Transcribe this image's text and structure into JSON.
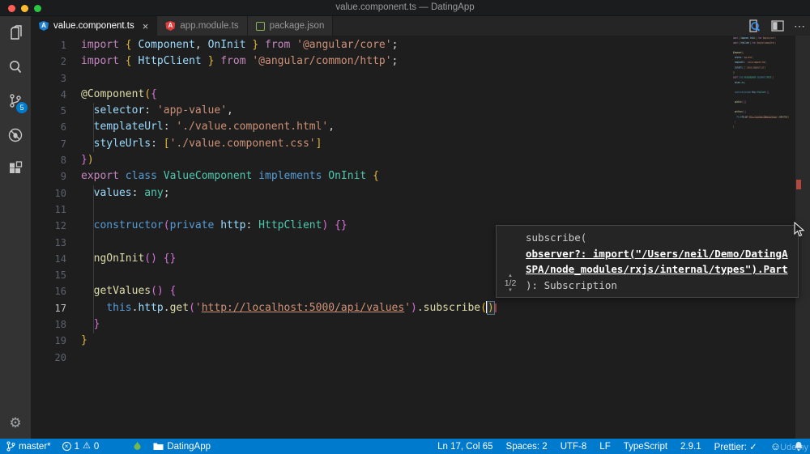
{
  "window": {
    "title": "value.component.ts — DatingApp"
  },
  "tabs": [
    {
      "label": "value.component.ts",
      "icon": "angular-blue",
      "active": true,
      "close_label": "×"
    },
    {
      "label": "app.module.ts",
      "icon": "angular-red",
      "active": false
    },
    {
      "label": "package.json",
      "icon": "npm",
      "active": false
    }
  ],
  "editor_actions": {
    "more_label": "⋯"
  },
  "activity_bar": {
    "scm_badge": "5",
    "gear_glyph": "⚙"
  },
  "editor": {
    "current_line": 17,
    "lines": [
      [
        [
          "kw",
          "import"
        ],
        [
          "pun",
          " "
        ],
        [
          "b1",
          "{"
        ],
        [
          "pun",
          " "
        ],
        [
          "var",
          "Component"
        ],
        [
          "pun",
          ", "
        ],
        [
          "var",
          "OnInit"
        ],
        [
          "pun",
          " "
        ],
        [
          "b1",
          "}"
        ],
        [
          "pun",
          " "
        ],
        [
          "kw",
          "from"
        ],
        [
          "pun",
          " "
        ],
        [
          "str",
          "'@angular/core'"
        ],
        [
          "pun",
          ";"
        ]
      ],
      [
        [
          "kw",
          "import"
        ],
        [
          "pun",
          " "
        ],
        [
          "b1",
          "{"
        ],
        [
          "pun",
          " "
        ],
        [
          "var",
          "HttpClient"
        ],
        [
          "pun",
          " "
        ],
        [
          "b1",
          "}"
        ],
        [
          "pun",
          " "
        ],
        [
          "kw",
          "from"
        ],
        [
          "pun",
          " "
        ],
        [
          "str",
          "'@angular/common/http'"
        ],
        [
          "pun",
          ";"
        ]
      ],
      [],
      [
        [
          "fn",
          "@Component"
        ],
        [
          "b1",
          "("
        ],
        [
          "b2",
          "{"
        ]
      ],
      [
        [
          "pun",
          "  "
        ],
        [
          "var",
          "selector"
        ],
        [
          "pun",
          ": "
        ],
        [
          "str",
          "'app-value'"
        ],
        [
          "pun",
          ","
        ]
      ],
      [
        [
          "pun",
          "  "
        ],
        [
          "var",
          "templateUrl"
        ],
        [
          "pun",
          ": "
        ],
        [
          "str",
          "'./value.component.html'"
        ],
        [
          "pun",
          ","
        ]
      ],
      [
        [
          "pun",
          "  "
        ],
        [
          "var",
          "styleUrls"
        ],
        [
          "pun",
          ": "
        ],
        [
          "b1",
          "["
        ],
        [
          "str",
          "'./value.component.css'"
        ],
        [
          "b1",
          "]"
        ]
      ],
      [
        [
          "b2",
          "}"
        ],
        [
          "b1",
          ")"
        ]
      ],
      [
        [
          "kw",
          "export"
        ],
        [
          "pun",
          " "
        ],
        [
          "kw2",
          "class"
        ],
        [
          "pun",
          " "
        ],
        [
          "type",
          "ValueComponent"
        ],
        [
          "pun",
          " "
        ],
        [
          "kw2",
          "implements"
        ],
        [
          "pun",
          " "
        ],
        [
          "type",
          "OnInit"
        ],
        [
          "pun",
          " "
        ],
        [
          "b1",
          "{"
        ]
      ],
      [
        [
          "pun",
          "  "
        ],
        [
          "var",
          "values"
        ],
        [
          "pun",
          ": "
        ],
        [
          "type",
          "any"
        ],
        [
          "pun",
          ";"
        ]
      ],
      [],
      [
        [
          "pun",
          "  "
        ],
        [
          "kw2",
          "constructor"
        ],
        [
          "b2",
          "("
        ],
        [
          "kw2",
          "private"
        ],
        [
          "pun",
          " "
        ],
        [
          "var",
          "http"
        ],
        [
          "pun",
          ": "
        ],
        [
          "type",
          "HttpClient"
        ],
        [
          "b2",
          ")"
        ],
        [
          "pun",
          " "
        ],
        [
          "b2",
          "{}"
        ]
      ],
      [],
      [
        [
          "pun",
          "  "
        ],
        [
          "fn",
          "ngOnInit"
        ],
        [
          "b2",
          "()"
        ],
        [
          "pun",
          " "
        ],
        [
          "b2",
          "{}"
        ]
      ],
      [],
      [
        [
          "pun",
          "  "
        ],
        [
          "fn",
          "getValues"
        ],
        [
          "b2",
          "()"
        ],
        [
          "pun",
          " "
        ],
        [
          "b2",
          "{"
        ]
      ],
      [
        [
          "pun",
          "    "
        ],
        [
          "kw2",
          "this"
        ],
        [
          "pun",
          "."
        ],
        [
          "var",
          "http"
        ],
        [
          "pun",
          "."
        ],
        [
          "fn",
          "get"
        ],
        [
          "b2",
          "("
        ],
        [
          "str",
          "'"
        ],
        [
          "strU",
          "http://localhost:5000/api/values"
        ],
        [
          "str",
          "'"
        ],
        [
          "b2",
          ")"
        ],
        [
          "pun",
          "."
        ],
        [
          "fn",
          "subscribe"
        ],
        [
          "b1",
          "("
        ],
        [
          "caret",
          ""
        ],
        [
          "b1m",
          ")"
        ]
      ],
      [
        [
          "pun",
          "  "
        ],
        [
          "b2",
          "}"
        ]
      ],
      [
        [
          "b1",
          "}"
        ]
      ],
      []
    ]
  },
  "tooltip": {
    "signature_open": "subscribe(",
    "param_line1": "observer?: import(\"/Users/neil/Demo/DatingA",
    "param_line2": "SPA/node_modules/rxjs/internal/types\").Part",
    "signature_close": "): Subscription",
    "pager": "1/2",
    "chevron_up": "▲",
    "chevron_down": "▼"
  },
  "status_bar": {
    "branch": "master*",
    "errors": "1",
    "warnings": "0",
    "error_glyph": "×",
    "warning_glyph": "⚠",
    "folder": "DatingApp",
    "line_col": "Ln 17, Col 65",
    "spaces": "Spaces: 2",
    "encoding": "UTF-8",
    "eol": "LF",
    "language": "TypeScript",
    "version": "2.9.1",
    "prettier": "Prettier: ✓",
    "smiley_glyph": "☺",
    "watermark": "Udemy"
  },
  "colors": {
    "accent": "#007acc",
    "angular_blue": "#1f7fd4",
    "angular_red": "#e03e3e",
    "npm_green": "#85b157",
    "flame_green": "#71b84f",
    "error_marker": "#b1473f"
  }
}
